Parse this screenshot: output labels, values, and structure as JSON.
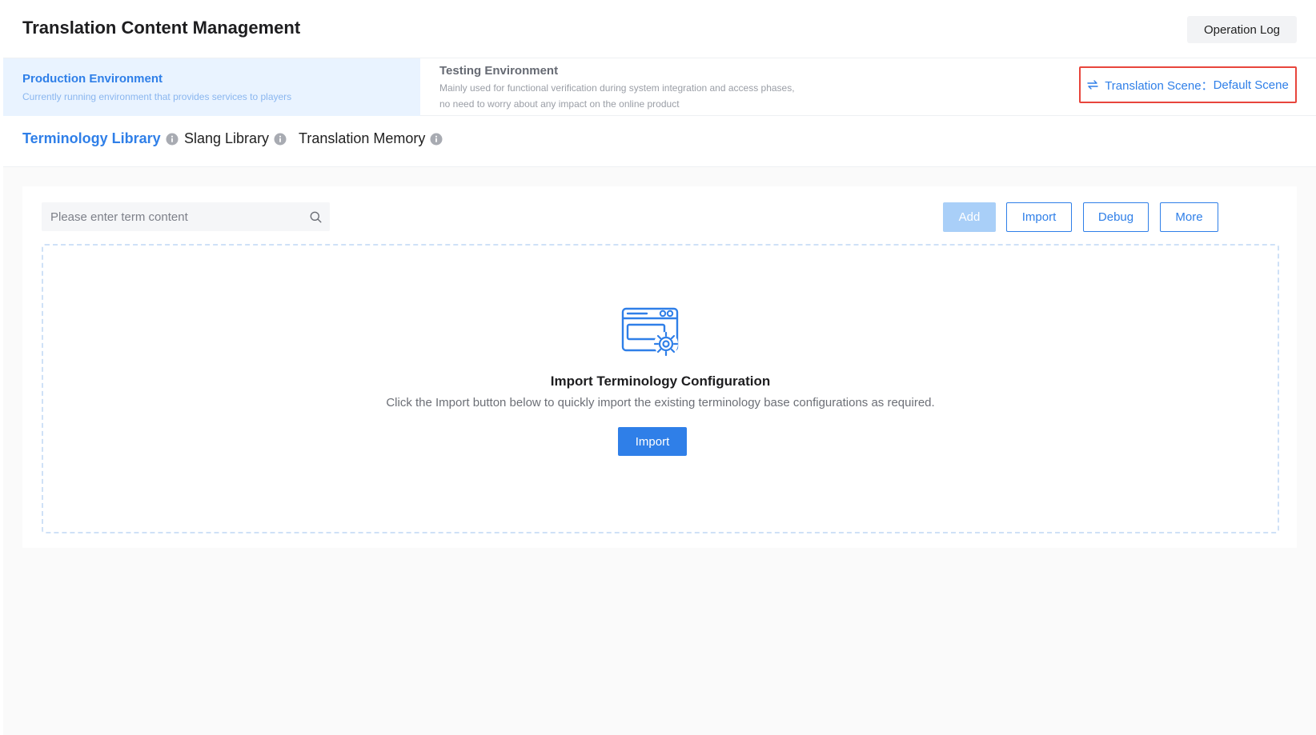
{
  "header": {
    "title": "Translation Content Management",
    "operation_log_label": "Operation Log"
  },
  "environments": {
    "production": {
      "name": "Production Environment",
      "description": "Currently running environment that provides services to players",
      "selected": true
    },
    "testing": {
      "name": "Testing Environment",
      "description": "Mainly used for functional verification during system integration and access phases, no need to worry about any impact on the online product",
      "selected": false
    }
  },
  "scene_switch": {
    "label": "Translation Scene：",
    "value": "Default Scene",
    "icon": "swap-icon"
  },
  "library_tabs": [
    {
      "label": "Terminology Library",
      "active": true,
      "icon": "info-icon"
    },
    {
      "label": "Slang Library",
      "active": false,
      "icon": "info-icon"
    },
    {
      "label": "Translation Memory",
      "active": false,
      "icon": "info-icon"
    }
  ],
  "search": {
    "placeholder": "Please enter term content",
    "value": "",
    "icon": "search-icon"
  },
  "toolbar": {
    "add_label": "Add",
    "import_label": "Import",
    "debug_label": "Debug",
    "more_label": "More"
  },
  "empty_state": {
    "icon": "browser-settings-icon",
    "title": "Import Terminology Configuration",
    "description": "Click the Import button below to quickly import the existing terminology base configurations as required.",
    "button_label": "Import"
  },
  "colors": {
    "accent": "#2f7fe8",
    "accent_disabled": "#a9cff8",
    "selected_env_bg": "#e9f3ff",
    "highlight_border": "#e8453c",
    "page_bg": "#fafafa"
  }
}
